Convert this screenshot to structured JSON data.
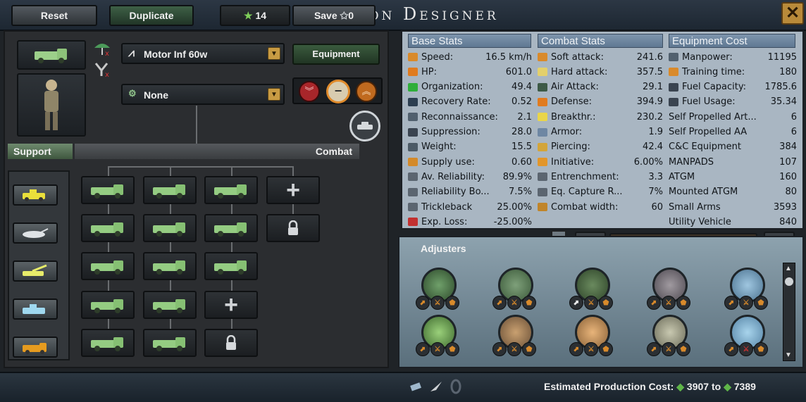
{
  "window": {
    "title": "Division Designer",
    "close_glyph": "✕"
  },
  "template": {
    "name": "Motor Inf 60w",
    "role": "None",
    "equipment_label": "Equipment"
  },
  "sections": {
    "support": "Support",
    "combat": "Combat"
  },
  "column_headers": {
    "base": "Base Stats",
    "combat": "Combat Stats",
    "equipment": "Equipment Cost"
  },
  "base_stats": [
    {
      "label": "Speed:",
      "value": "16.5 km/h",
      "icon": "speed-icon",
      "color": "#d98a2b"
    },
    {
      "label": "HP:",
      "value": "601.0",
      "icon": "hp-icon",
      "color": "#e07b1f"
    },
    {
      "label": "Organization:",
      "value": "49.4",
      "icon": "organization-icon",
      "color": "#2fae3a"
    },
    {
      "label": "Recovery Rate:",
      "value": "0.52",
      "icon": "recovery-icon",
      "color": "#2c3e50"
    },
    {
      "label": "Reconnaissance:",
      "value": "2.1",
      "icon": "recon-icon",
      "color": "#51606e"
    },
    {
      "label": "Suppression:",
      "value": "28.0",
      "icon": "suppression-icon",
      "color": "#3a4450"
    },
    {
      "label": "Weight:",
      "value": "15.5",
      "icon": "weight-icon",
      "color": "#4c5a66"
    },
    {
      "label": "Supply use:",
      "value": "0.60",
      "icon": "supply-icon",
      "color": "#d38a2a"
    },
    {
      "label": "Av. Reliability:",
      "value": "89.9%",
      "icon": "reliability-icon",
      "color": "#5b6570"
    },
    {
      "label": "Reliability Bo...",
      "value": "7.5%",
      "icon": "reliability-bonus-icon",
      "color": "#5b6570"
    },
    {
      "label": "Trickleback",
      "value": "25.00%",
      "icon": "trickleback-icon",
      "color": "#5b6570"
    },
    {
      "label": "Exp. Loss:",
      "value": "-25.00%",
      "icon": "exp-loss-icon",
      "color": "#c23030"
    }
  ],
  "combat_stats": [
    {
      "label": "Soft attack:",
      "value": "241.6",
      "icon": "soft-attack-icon",
      "color": "#d98a2b"
    },
    {
      "label": "Hard attack:",
      "value": "357.5",
      "icon": "hard-attack-icon",
      "color": "#e3d06b"
    },
    {
      "label": "Air Attack:",
      "value": "29.1",
      "icon": "air-attack-icon",
      "color": "#3d5a46"
    },
    {
      "label": "Defense:",
      "value": "394.9",
      "icon": "defense-icon",
      "color": "#e07b1f"
    },
    {
      "label": "Breakthr.:",
      "value": "230.2",
      "icon": "breakthrough-icon",
      "color": "#e9d54a"
    },
    {
      "label": "Armor:",
      "value": "1.9",
      "icon": "armor-icon",
      "color": "#6e87a3"
    },
    {
      "label": "Piercing:",
      "value": "42.4",
      "icon": "piercing-icon",
      "color": "#d3a53a"
    },
    {
      "label": "Initiative:",
      "value": "6.00%",
      "icon": "initiative-icon",
      "color": "#e2962b"
    },
    {
      "label": "Entrenchment:",
      "value": "3.3",
      "icon": "entrenchment-icon",
      "color": "#5b6570"
    },
    {
      "label": "Eq. Capture R...",
      "value": "7%",
      "icon": "capture-icon",
      "color": "#5b6570"
    },
    {
      "label": "Combat width:",
      "value": "60",
      "icon": "combat-width-icon",
      "color": "#c0852a"
    }
  ],
  "equipment_cost": [
    {
      "label": "Manpower:",
      "value": "11195",
      "icon": "manpower-icon",
      "color": "#51606e"
    },
    {
      "label": "Training time:",
      "value": "180",
      "icon": "training-icon",
      "color": "#d98a2b"
    },
    {
      "label": "Fuel Capacity:",
      "value": "1785.6",
      "icon": "fuel-capacity-icon",
      "color": "#3a4450"
    },
    {
      "label": "Fuel Usage:",
      "value": "35.34",
      "icon": "fuel-usage-icon",
      "color": "#3a4450"
    },
    {
      "label": "Self Propelled Art...",
      "value": "6",
      "icon": "",
      "color": ""
    },
    {
      "label": "Self Propelled AA",
      "value": "6",
      "icon": "",
      "color": ""
    },
    {
      "label": "C&C Equipment",
      "value": "384",
      "icon": "",
      "color": ""
    },
    {
      "label": "MANPADS",
      "value": "107",
      "icon": "",
      "color": ""
    },
    {
      "label": "ATGM",
      "value": "160",
      "icon": "",
      "color": ""
    },
    {
      "label": "Mounted ATGM",
      "value": "80",
      "icon": "",
      "color": ""
    },
    {
      "label": "Small Arms",
      "value": "3593",
      "icon": "",
      "color": ""
    },
    {
      "label": "Utility Vehicle",
      "value": "840",
      "icon": "",
      "color": ""
    }
  ],
  "adjusters": {
    "title": "Adjusters"
  },
  "bottom": {
    "reset": "Reset",
    "duplicate": "Duplicate",
    "xp": "14",
    "save": "Save",
    "save_cost": "0",
    "production_label": "Estimated Production Cost:",
    "production_min": "3907",
    "production_to": "to",
    "production_max": "7389"
  }
}
